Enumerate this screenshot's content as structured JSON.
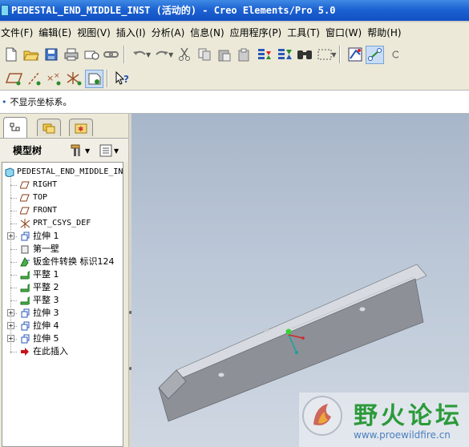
{
  "window": {
    "title": "PEDESTAL_END_MIDDLE_INST (活动的) - Creo Elements/Pro 5.0"
  },
  "menu": [
    "文件(F)",
    "编辑(E)",
    "视图(V)",
    "插入(I)",
    "分析(A)",
    "信息(N)",
    "应用程序(P)",
    "工具(T)",
    "窗口(W)",
    "帮助(H)"
  ],
  "toolbar_icons": {
    "row1": [
      "new-file-icon",
      "open-folder-icon",
      "save-icon",
      "print-icon",
      "send-mail-icon",
      "link-icon",
      "undo-icon",
      "redo-icon",
      "cut-icon",
      "copy-icon",
      "paste-icon",
      "paste-special-icon",
      "regenerate-icon",
      "regenerate-manager-icon",
      "find-icon",
      "select-box-icon",
      "redo-box-icon",
      "flat-pattern-icon",
      "sketch-toggle-icon"
    ],
    "row2": [
      "datum-plane-toggle-icon",
      "datum-axis-toggle-icon",
      "datum-point-toggle-icon",
      "csys-toggle-icon",
      "spin-center-icon",
      "context-help-icon"
    ]
  },
  "message": {
    "text": "不显示坐标系。"
  },
  "model_tree": {
    "header": "模型树",
    "root": "PEDESTAL_END_MIDDLE_IN",
    "items": [
      {
        "label": "RIGHT",
        "icon": "datum-plane-icon",
        "expandable": false
      },
      {
        "label": "TOP",
        "icon": "datum-plane-icon",
        "expandable": false
      },
      {
        "label": "FRONT",
        "icon": "datum-plane-icon",
        "expandable": false
      },
      {
        "label": "PRT_CSYS_DEF",
        "icon": "coordinate-system-icon",
        "expandable": false
      },
      {
        "label": "拉伸 1",
        "icon": "extrude-icon",
        "expandable": true
      },
      {
        "label": "第一壁",
        "icon": "first-wall-icon",
        "expandable": false
      },
      {
        "label": "钣金件转换 标识124",
        "icon": "sheetmetal-conversion-icon",
        "expandable": false
      },
      {
        "label": "平整 1",
        "icon": "flat-wall-icon",
        "expandable": false
      },
      {
        "label": "平整 2",
        "icon": "flat-wall-icon",
        "expandable": false
      },
      {
        "label": "平整 3",
        "icon": "flat-wall-icon",
        "expandable": false
      },
      {
        "label": "拉伸 3",
        "icon": "extrude-icon",
        "expandable": true
      },
      {
        "label": "拉伸 4",
        "icon": "extrude-icon",
        "expandable": true
      },
      {
        "label": "拉伸 5",
        "icon": "extrude-icon",
        "expandable": true
      },
      {
        "label": "在此插入",
        "icon": "insert-here-arrow-icon",
        "expandable": false
      }
    ]
  },
  "watermark": {
    "title": "野火论坛",
    "url": "www.proewildfire.cn"
  },
  "colors": {
    "title_bar": "#1c62d2",
    "viewport_top": "#a7b6c9",
    "viewport_bottom": "#cfd7e2",
    "part_face": "#8d9096",
    "watermark_green": "#2b9a3a"
  }
}
